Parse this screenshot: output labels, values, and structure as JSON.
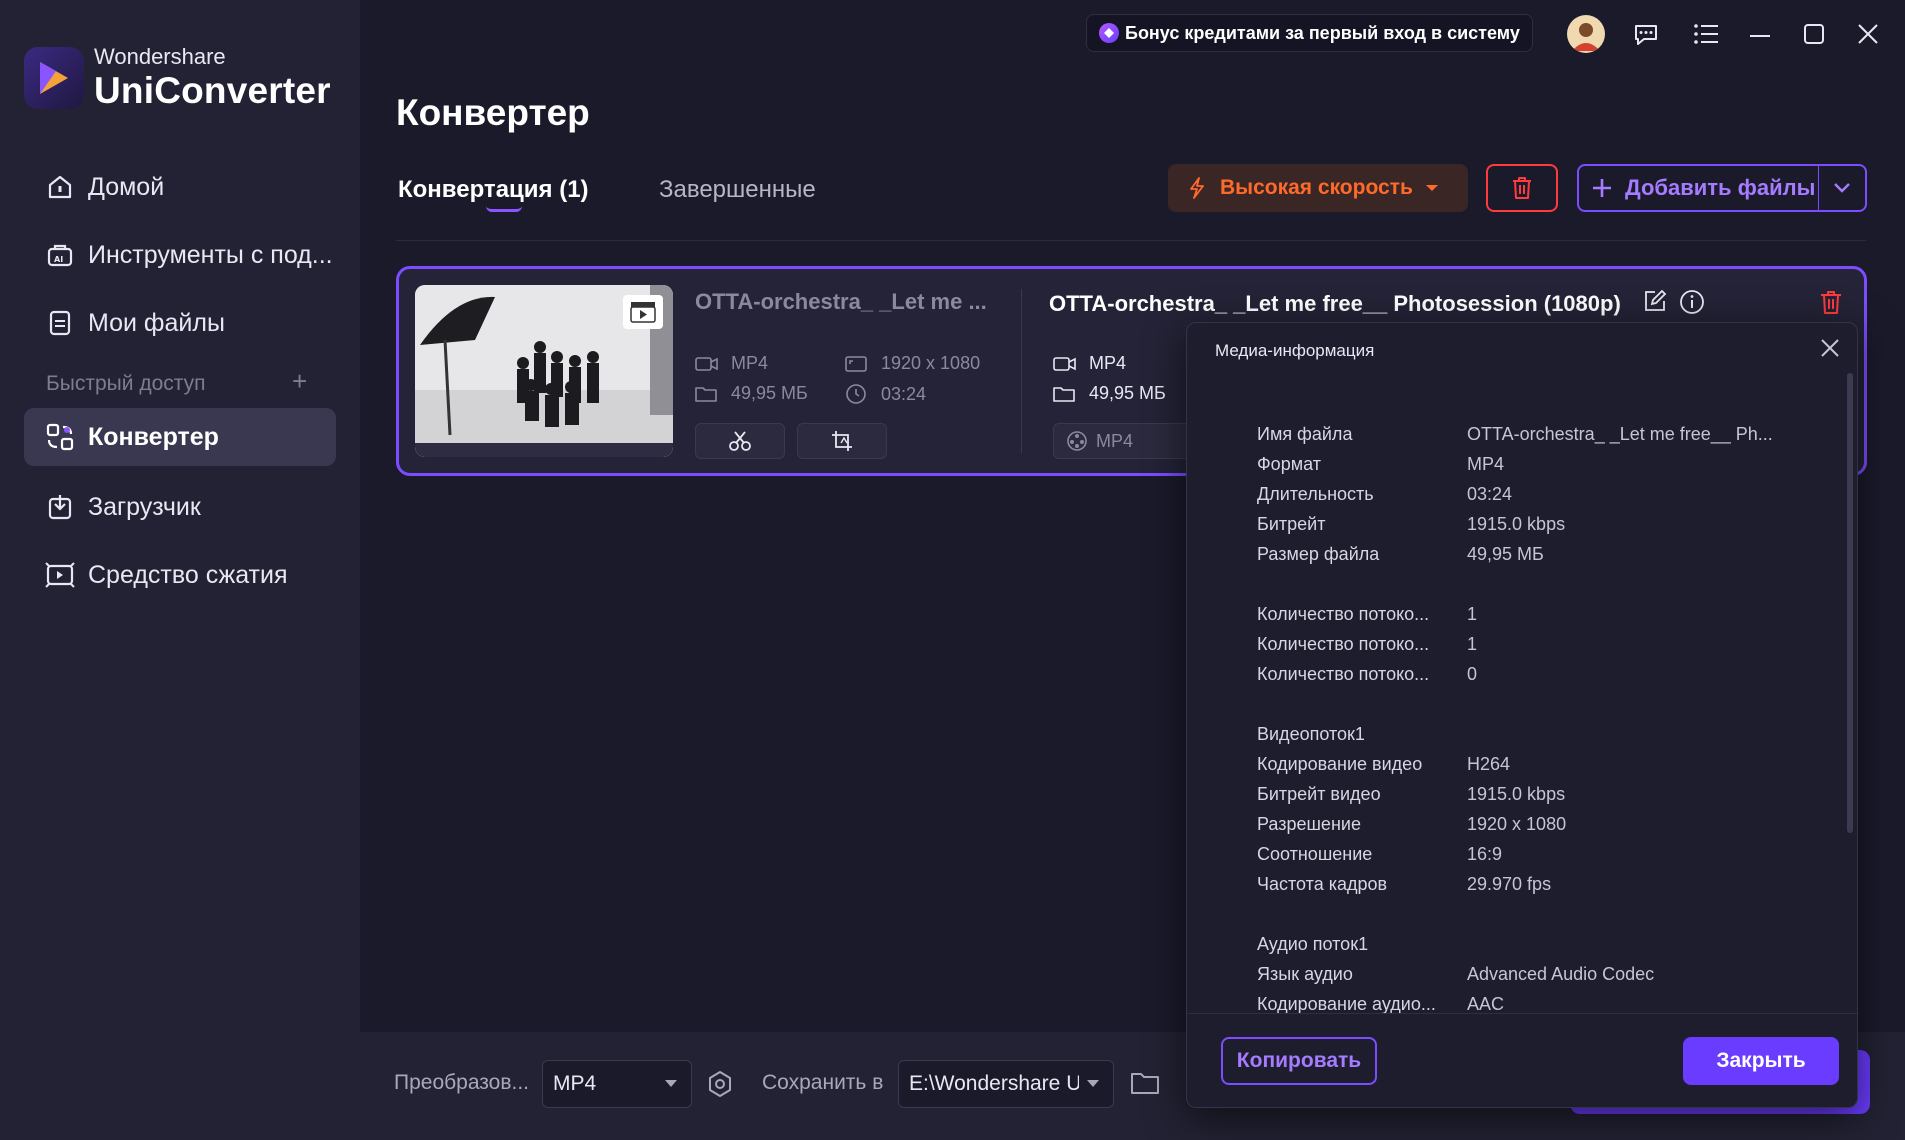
{
  "app": {
    "brand_top": "Wondershare",
    "brand_name": "UniConverter"
  },
  "topbar": {
    "bonus": "Бонус кредитами за первый вход в систему"
  },
  "sidebar": {
    "items": [
      {
        "label": "Домой",
        "icon": "home-icon"
      },
      {
        "label": "Инструменты с под...",
        "icon": "ai-tools-icon"
      },
      {
        "label": "Мои файлы",
        "icon": "files-icon"
      },
      {
        "label": "Конвертер",
        "icon": "converter-icon",
        "active": true
      },
      {
        "label": "Загрузчик",
        "icon": "download-icon"
      },
      {
        "label": "Средство сжатия",
        "icon": "compress-icon"
      }
    ],
    "quick_access": "Быстрый доступ",
    "quick_add": "+"
  },
  "main": {
    "title": "Конвертер",
    "tabs": [
      {
        "label": "Конвертация (1)"
      },
      {
        "label": "Завершенные"
      }
    ],
    "speed_label": "Высокая скорость",
    "add_files_label": "Добавить файлы"
  },
  "file": {
    "source_name": "OTTA-orchestra_ _Let me ...",
    "source_format": "MP4",
    "source_resolution": "1920 x 1080",
    "source_size": "49,95 МБ",
    "source_duration": "03:24",
    "target_name": "OTTA-orchestra_ _Let me free__ Photosession (1080p)",
    "target_format": "MP4",
    "target_size": "49,95 МБ",
    "output_format": "MP4"
  },
  "bottom": {
    "convert_label": "Преобразов...",
    "convert_value": "MP4",
    "save_label": "Сохранить в",
    "save_value": "E:\\Wondershare U"
  },
  "modal": {
    "title": "Медиа-информация",
    "copy_label": "Копировать",
    "close_label": "Закрыть",
    "groups": [
      [
        {
          "k": "Имя файла",
          "v": "OTTA-orchestra_ _Let me free__ Ph..."
        },
        {
          "k": "Формат",
          "v": "MP4"
        },
        {
          "k": "Длительность",
          "v": "03:24"
        },
        {
          "k": "Битрейт",
          "v": "1915.0 kbps"
        },
        {
          "k": "Размер файла",
          "v": "49,95 МБ"
        }
      ],
      [
        {
          "k": "Количество потоко...",
          "v": "1"
        },
        {
          "k": "Количество потоко...",
          "v": "1"
        },
        {
          "k": "Количество потоко...",
          "v": "0"
        }
      ],
      [
        {
          "k": "Видеопоток1",
          "v": ""
        },
        {
          "k": "Кодирование видео",
          "v": "H264"
        },
        {
          "k": "Битрейт видео",
          "v": "1915.0 kbps"
        },
        {
          "k": "Разрешение",
          "v": "1920 x 1080"
        },
        {
          "k": "Соотношение",
          "v": "16:9"
        },
        {
          "k": "Частота кадров",
          "v": "29.970 fps"
        }
      ],
      [
        {
          "k": "Аудио поток1",
          "v": ""
        },
        {
          "k": "Язык аудио",
          "v": "Advanced Audio Codec"
        },
        {
          "k": "Кодирование аудио...",
          "v": "AAC"
        }
      ]
    ]
  }
}
